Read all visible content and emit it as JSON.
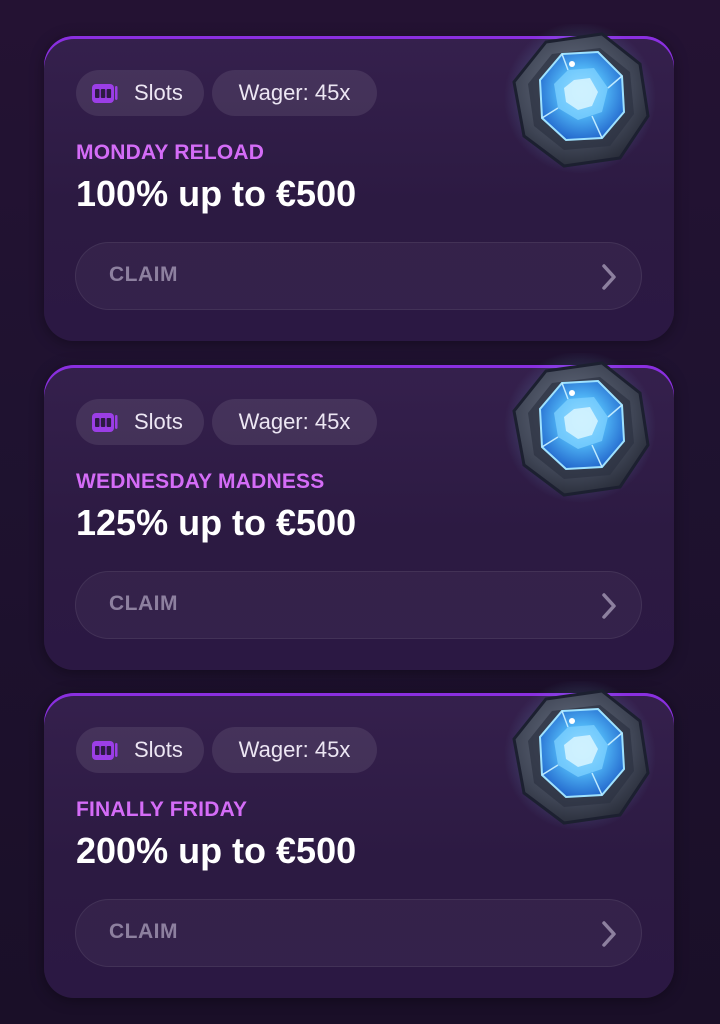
{
  "promotions": [
    {
      "category": "Slots",
      "wager": "Wager: 45x",
      "name": "MONDAY RELOAD",
      "offer": "100% up to €500",
      "claim_label": "CLAIM",
      "icon": "blue-gem-icon"
    },
    {
      "category": "Slots",
      "wager": "Wager: 45x",
      "name": "WEDNESDAY MADNESS",
      "offer": "125% up to €500",
      "claim_label": "CLAIM",
      "icon": "blue-gem-icon"
    },
    {
      "category": "Slots",
      "wager": "Wager: 45x",
      "name": "FINALLY FRIDAY",
      "offer": "200% up to €500",
      "claim_label": "CLAIM",
      "icon": "blue-gem-icon"
    }
  ],
  "colors": {
    "background": "#1f1230",
    "card": "#2f1c46",
    "accent_border": "#8a2fe0",
    "promo_name": "#d46cf7",
    "offer_text": "#ffffff",
    "claim_text": "#8d809f",
    "gem": "#3f9fee"
  }
}
